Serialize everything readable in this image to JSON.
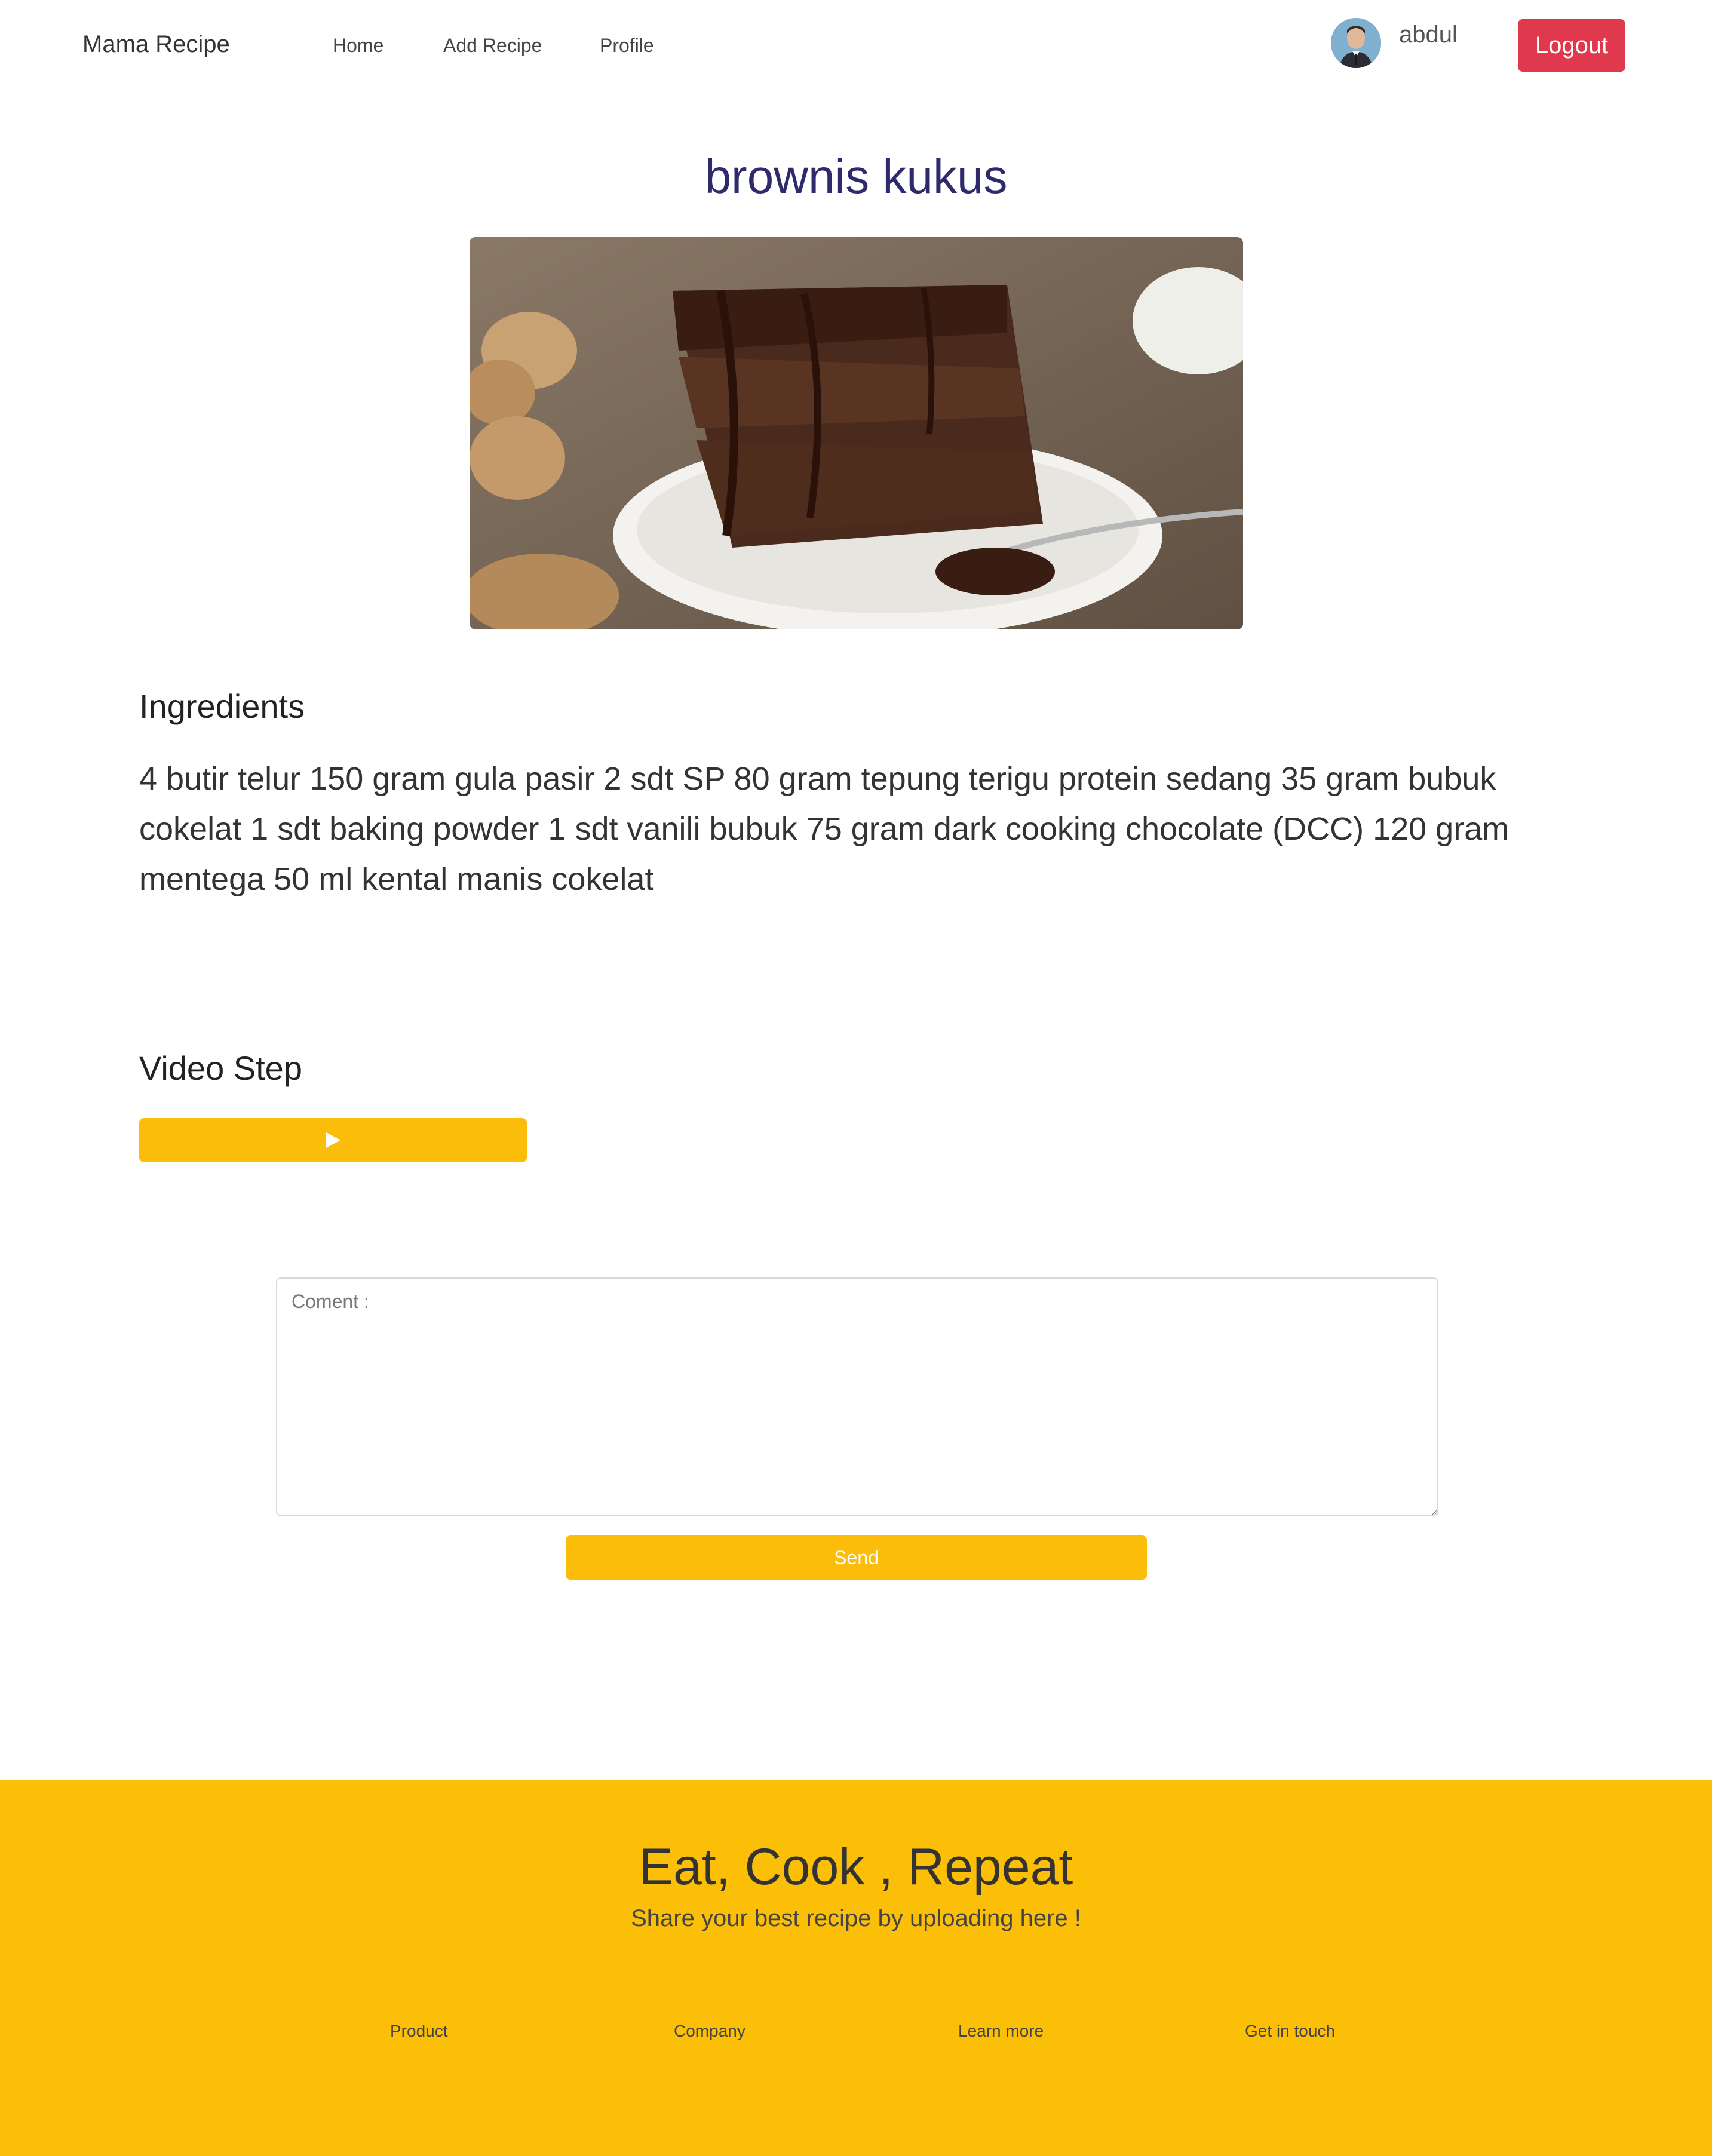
{
  "navbar": {
    "brand": "Mama Recipe",
    "links": [
      "Home",
      "Add Recipe",
      "Profile"
    ],
    "username": "abdul",
    "logout_label": "Logout"
  },
  "recipe": {
    "title": "brownis kukus",
    "ingredients_heading": "Ingredients",
    "ingredients_text": "4 butir telur 150 gram gula pasir 2 sdt SP 80 gram tepung terigu protein sedang 35 gram bubuk cokelat 1 sdt baking powder 1 sdt vanili bubuk 75 gram dark cooking chocolate (DCC) 120 gram mentega 50 ml kental manis cokelat",
    "video_heading": "Video Step"
  },
  "comment": {
    "placeholder": "Coment :",
    "value": "",
    "send_label": "Send"
  },
  "footer": {
    "title": "Eat, Cook , Repeat",
    "subtitle": "Share your best recipe by uploading here !",
    "links": [
      "Product",
      "Company",
      "Learn more",
      "Get in touch"
    ]
  },
  "colors": {
    "accent": "#fcbd0a",
    "logout": "#e0384c",
    "title": "#2e2a6b"
  },
  "icons": {
    "video_button": "play-icon"
  }
}
